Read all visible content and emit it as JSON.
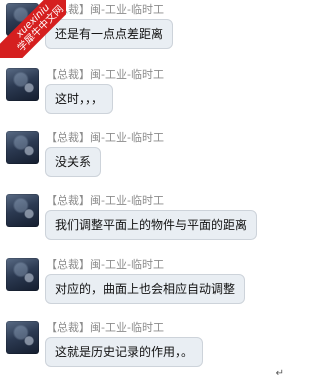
{
  "watermark": {
    "line1": "xuexiniu",
    "line2": "学犀牛中文网"
  },
  "messages": [
    {
      "sender": "【总裁】闽-工业-临时工",
      "text": "还是有一点点差距离"
    },
    {
      "sender": "【总裁】闽-工业-临时工",
      "text": "这时，，，"
    },
    {
      "sender": "【总裁】闽-工业-临时工",
      "text": "没关系"
    },
    {
      "sender": "【总裁】闽-工业-临时工",
      "text": "我们调整平面上的物件与平面的距离"
    },
    {
      "sender": "【总裁】闽-工业-临时工",
      "text": "对应的，曲面上也会相应自动调整"
    },
    {
      "sender": "【总裁】闽-工业-临时工",
      "text": "这就是历史记录的作用，。"
    }
  ],
  "corner_symbol": "↵"
}
